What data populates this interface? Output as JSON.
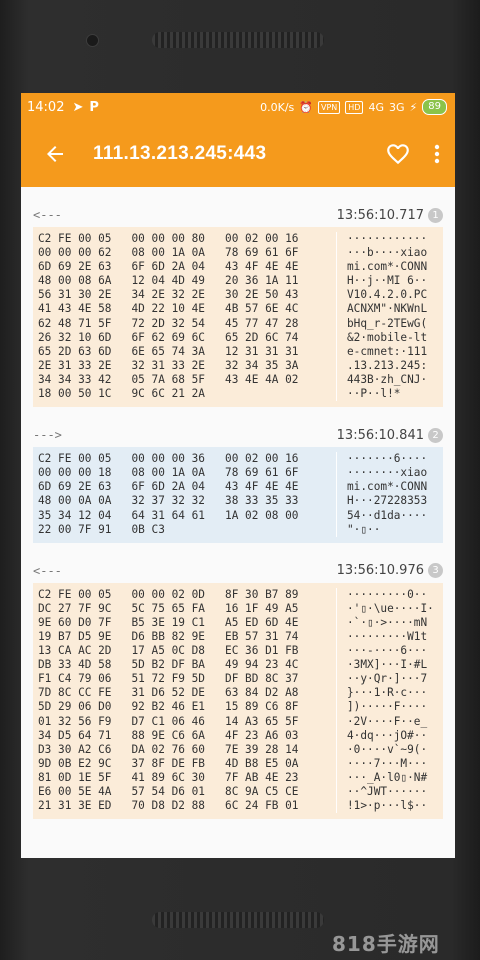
{
  "status": {
    "time": "14:02",
    "speed": "0.0K/s",
    "vpn": "VPN",
    "hd": "HD",
    "net4g": "4G",
    "net3g": "3G",
    "battery": "89"
  },
  "appbar": {
    "title": "111.13.213.245:443"
  },
  "colors": {
    "accent": "#f59a1c",
    "outgoing_bg": "#fbecd9",
    "incoming_bg": "#e3edf5"
  },
  "messages": [
    {
      "direction": "<---",
      "time": "13:56:10.717",
      "index": "1",
      "hex": [
        "C2 FE 00 05   00 00 00 80   00 02 00 16",
        "00 00 00 62   08 00 1A 0A   78 69 61 6F",
        "6D 69 2E 63   6F 6D 2A 04   43 4F 4E 4E",
        "48 00 08 6A   12 04 4D 49   20 36 1A 11",
        "56 31 30 2E   34 2E 32 2E   30 2E 50 43",
        "41 43 4E 58   4D 22 10 4E   4B 57 6E 4C",
        "62 48 71 5F   72 2D 32 54   45 77 47 28",
        "26 32 10 6D   6F 62 69 6C   65 2D 6C 74",
        "65 2D 63 6D   6E 65 74 3A   12 31 31 31",
        "2E 31 33 2E   32 31 33 2E   32 34 35 3A",
        "34 34 33 42   05 7A 68 5F   43 4E 4A 02",
        "18 00 50 1C   9C 6C 21 2A"
      ],
      "ascii": [
        "············",
        "···b····xiao",
        "mi.com*·CONN",
        "H··j··MI 6··",
        "V10.4.2.0.PC",
        "ACNXM\"·NKWnL",
        "bHq_r-2TEwG(",
        "&2·mobile-lt",
        "e-cmnet:·111",
        ".13.213.245:",
        "443B·zh_CNJ·",
        "··P··l!*"
      ]
    },
    {
      "direction": "--->",
      "time": "13:56:10.841",
      "index": "2",
      "hex": [
        "C2 FE 00 05   00 00 00 36   00 02 00 16",
        "00 00 00 18   08 00 1A 0A   78 69 61 6F",
        "6D 69 2E 63   6F 6D 2A 04   43 4F 4E 4E",
        "48 00 0A 0A   32 37 32 32   38 33 35 33",
        "35 34 12 04   64 31 64 61   1A 02 08 00",
        "22 00 7F 91   0B C3"
      ],
      "ascii": [
        "·······6····",
        "········xiao",
        "mi.com*·CONN",
        "H···27228353",
        "54··d1da····",
        "\"·▯··"
      ]
    },
    {
      "direction": "<---",
      "time": "13:56:10.976",
      "index": "3",
      "hex": [
        "C2 FE 00 05   00 00 02 0D   8F 30 B7 89",
        "DC 27 7F 9C   5C 75 65 FA   16 1F 49 A5",
        "9E 60 D0 7F   B5 3E 19 C1   A5 ED 6D 4E",
        "19 B7 D5 9E   D6 BB 82 9E   EB 57 31 74",
        "13 CA AC 2D   17 A5 0C D8   EC 36 D1 FB",
        "DB 33 4D 58   5D B2 DF BA   49 94 23 4C",
        "F1 C4 79 06   51 72 F9 5D   DF BD 8C 37",
        "7D 8C CC FE   31 D6 52 DE   63 84 D2 A8",
        "5D 29 06 D0   92 B2 46 E1   15 89 C6 8F",
        "01 32 56 F9   D7 C1 06 46   14 A3 65 5F",
        "34 D5 64 71   88 9E C6 6A   4F 23 A6 03",
        "D3 30 A2 C6   DA 02 76 60   7E 39 28 14",
        "9D 0B E2 9C   37 8F DE FB   4D B8 E5 0A",
        "81 0D 1E 5F   41 89 6C 30   7F AB 4E 23",
        "E6 00 5E 4A   57 54 D6 01   8C 9A C5 CE",
        "21 31 3E ED   70 D8 D2 88   6C 24 FB 01"
      ],
      "ascii": [
        "·········0··",
        "·'▯·\\ue····I·",
        "·`·▯·>····mN",
        "·········W1t",
        "···-····6···",
        "·3MX]···I·#L",
        "··y·Qr·]···7",
        "}···1·R·c···",
        "])·····F····",
        "·2V····F··e_",
        "4·dq···jO#··",
        "·0····v`~9(·",
        "····7···M···",
        "···_A·l0▯·N#",
        "··^JWT······",
        "!1>·p···l$··"
      ]
    }
  ]
}
